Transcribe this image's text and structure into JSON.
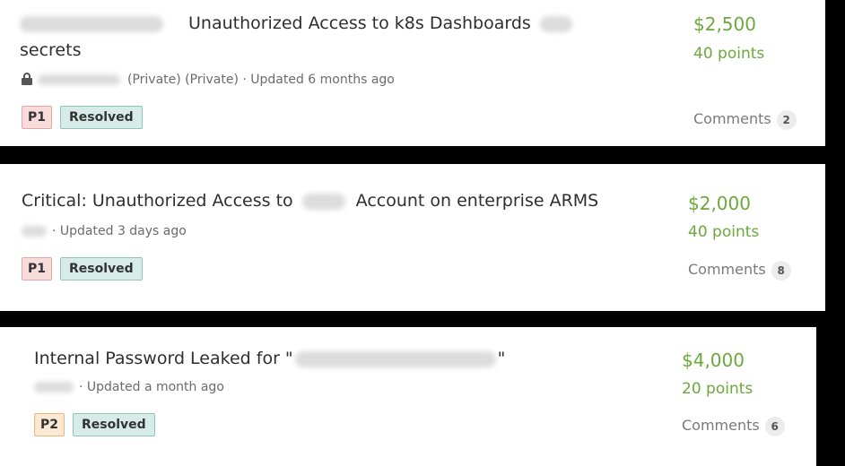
{
  "reports": [
    {
      "title_part": "Unauthorized Access to k8s Dashboards",
      "title_line2": "secrets",
      "meta_text": "(Private) (Private) · Updated 6 months ago",
      "priority": "P1",
      "status": "Resolved",
      "bounty": "$2,500",
      "points": "40 points",
      "comments_label": "Comments",
      "comments_count": "2"
    },
    {
      "title_before": "Critical: Unauthorized Access to",
      "title_after": "Account on enterprise ARMS",
      "meta_text": "· Updated 3 days ago",
      "priority": "P1",
      "status": "Resolved",
      "bounty": "$2,000",
      "points": "40 points",
      "comments_label": "Comments",
      "comments_count": "8"
    },
    {
      "title_before": "Internal Password Leaked for \"",
      "title_after": "\"",
      "meta_text": "· Updated a month ago",
      "priority": "P2",
      "status": "Resolved",
      "bounty": "$4,000",
      "points": "20 points",
      "comments_label": "Comments",
      "comments_count": "6"
    }
  ],
  "colors": {
    "bounty_green": "#6ca83c",
    "p1_bg": "#f8dcdc",
    "p2_bg": "#fde8d2",
    "resolved_bg": "#d7ece7"
  }
}
